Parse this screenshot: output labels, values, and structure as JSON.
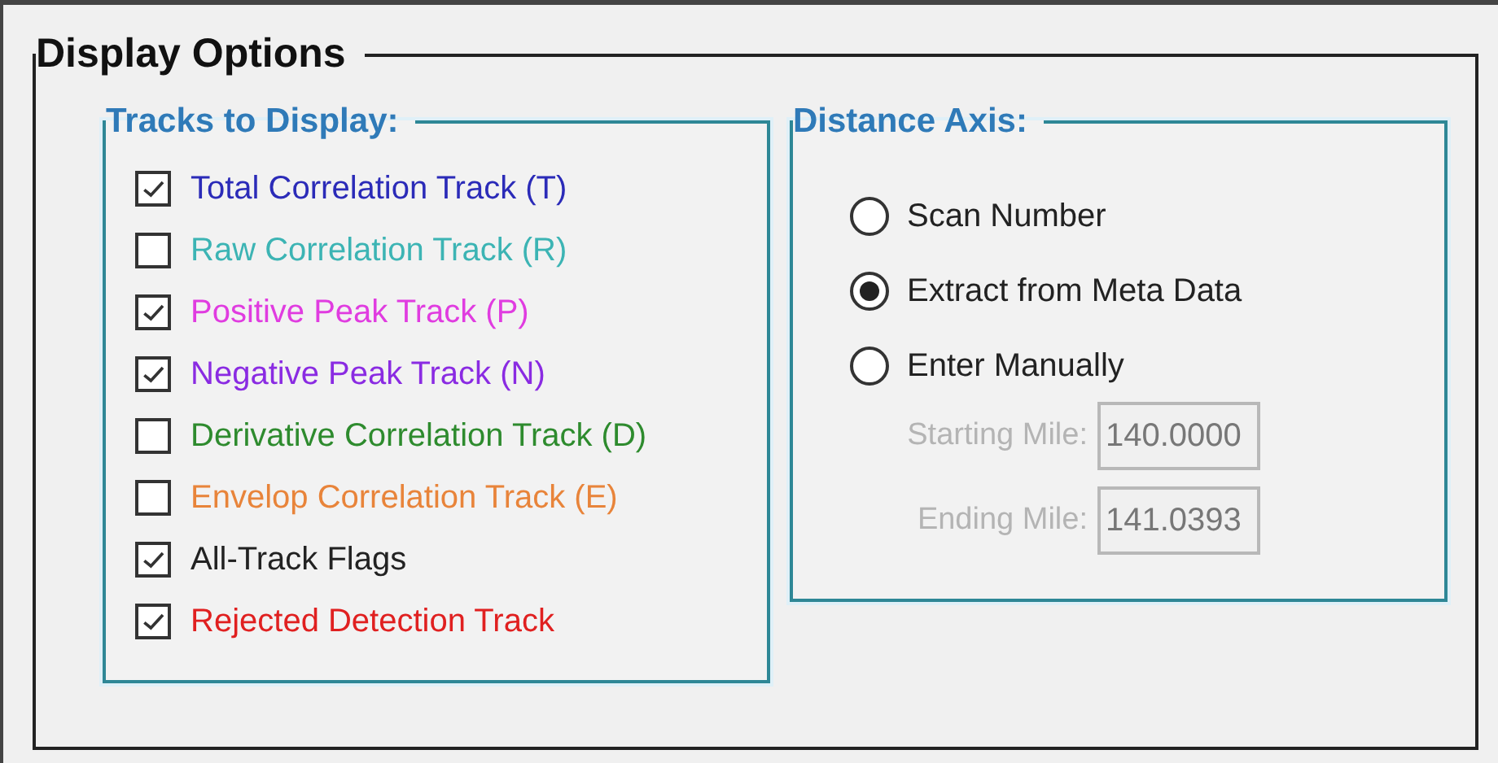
{
  "panel": {
    "title": "Display Options"
  },
  "tracks": {
    "title": "Tracks to Display:",
    "items": [
      {
        "label": "Total Correlation Track (T)",
        "checked": true,
        "color": "#2b2bb8"
      },
      {
        "label": "Raw Correlation Track (R)",
        "checked": false,
        "color": "#3cb4b4"
      },
      {
        "label": "Positive Peak Track (P)",
        "checked": true,
        "color": "#e03ce0"
      },
      {
        "label": "Negative Peak Track (N)",
        "checked": true,
        "color": "#8a2be2"
      },
      {
        "label": "Derivative Correlation Track (D)",
        "checked": false,
        "color": "#2e8b2e"
      },
      {
        "label": "Envelop Correlation Track (E)",
        "checked": false,
        "color": "#e8843a"
      },
      {
        "label": "All-Track Flags",
        "checked": true,
        "color": "#222222"
      },
      {
        "label": "Rejected Detection Track",
        "checked": true,
        "color": "#e02020"
      }
    ]
  },
  "distance_axis": {
    "title": "Distance Axis:",
    "options": [
      {
        "label": "Scan Number",
        "selected": false
      },
      {
        "label": "Extract from Meta Data",
        "selected": true
      },
      {
        "label": "Enter Manually",
        "selected": false
      }
    ],
    "fields": [
      {
        "label": "Starting Mile:",
        "value": "140.0000",
        "disabled": true
      },
      {
        "label": "Ending Mile:",
        "value": "141.0393",
        "disabled": true
      }
    ]
  }
}
